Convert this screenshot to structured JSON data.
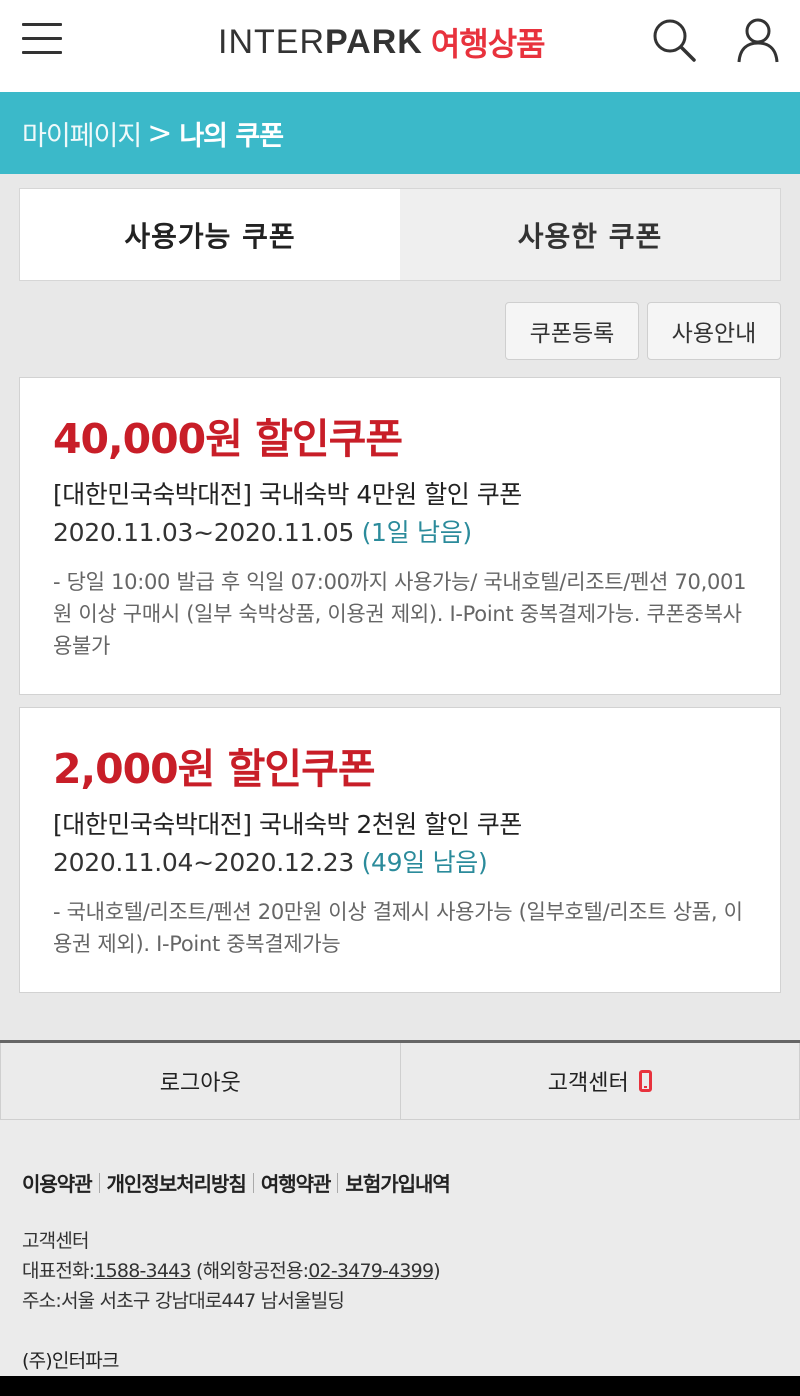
{
  "header": {
    "menu_icon": "hamburger-menu-icon",
    "logo_brand_light": "INTER",
    "logo_brand_bold": "PARK",
    "logo_sub": "여행상품",
    "search_icon": "search-icon",
    "user_icon": "user-icon",
    "brand_color": "#e8323d"
  },
  "breadcrumb": {
    "parent": "마이페이지",
    "separator": ">",
    "current": "나의 쿠폰",
    "bg_color": "#3bb9c9"
  },
  "tabs": [
    {
      "label": "사용가능 쿠폰",
      "active": true
    },
    {
      "label": "사용한 쿠폰",
      "active": false
    }
  ],
  "actions": {
    "register_label": "쿠폰등록",
    "guide_label": "사용안내"
  },
  "coupons": [
    {
      "title": "40,000원 할인쿠폰",
      "name": "[대한민국숙박대전] 국내숙박 4만원 할인 쿠폰",
      "period": "2020.11.03~2020.11.05",
      "remaining": "(1일 남음)",
      "description": "- 당일 10:00 발급 후 익일 07:00까지 사용가능/ 국내호텔/리조트/펜션 70,001원 이상 구매시 (일부 숙박상품, 이용권 제외). I-Point 중복결제가능. 쿠폰중복사용불가"
    },
    {
      "title": "2,000원 할인쿠폰",
      "name": "[대한민국숙박대전] 국내숙박 2천원 할인 쿠폰",
      "period": "2020.11.04~2020.12.23",
      "remaining": "(49일 남음)",
      "description": "- 국내호텔/리조트/펜션 20만원 이상 결제시 사용가능 (일부호텔/리조트 상품, 이용권 제외). I-Point 중복결제가능"
    }
  ],
  "footer_buttons": {
    "logout_label": "로그아웃",
    "customer_center_label": "고객센터",
    "phone_icon": "mobile-phone-icon"
  },
  "footer": {
    "links": [
      "이용약관",
      "개인정보처리방침",
      "여행약관",
      "보험가입내역"
    ],
    "contact_title": "고객센터",
    "phone_label": "대표전화:",
    "phone_number": "1588-3443",
    "overseas_prefix": "(해외항공전용:",
    "overseas_number": "02-3479-4399",
    "overseas_suffix": ")",
    "address": "주소:서울 서초구 강남대로447 남서울빌딩",
    "company": "(주)인터파크"
  }
}
